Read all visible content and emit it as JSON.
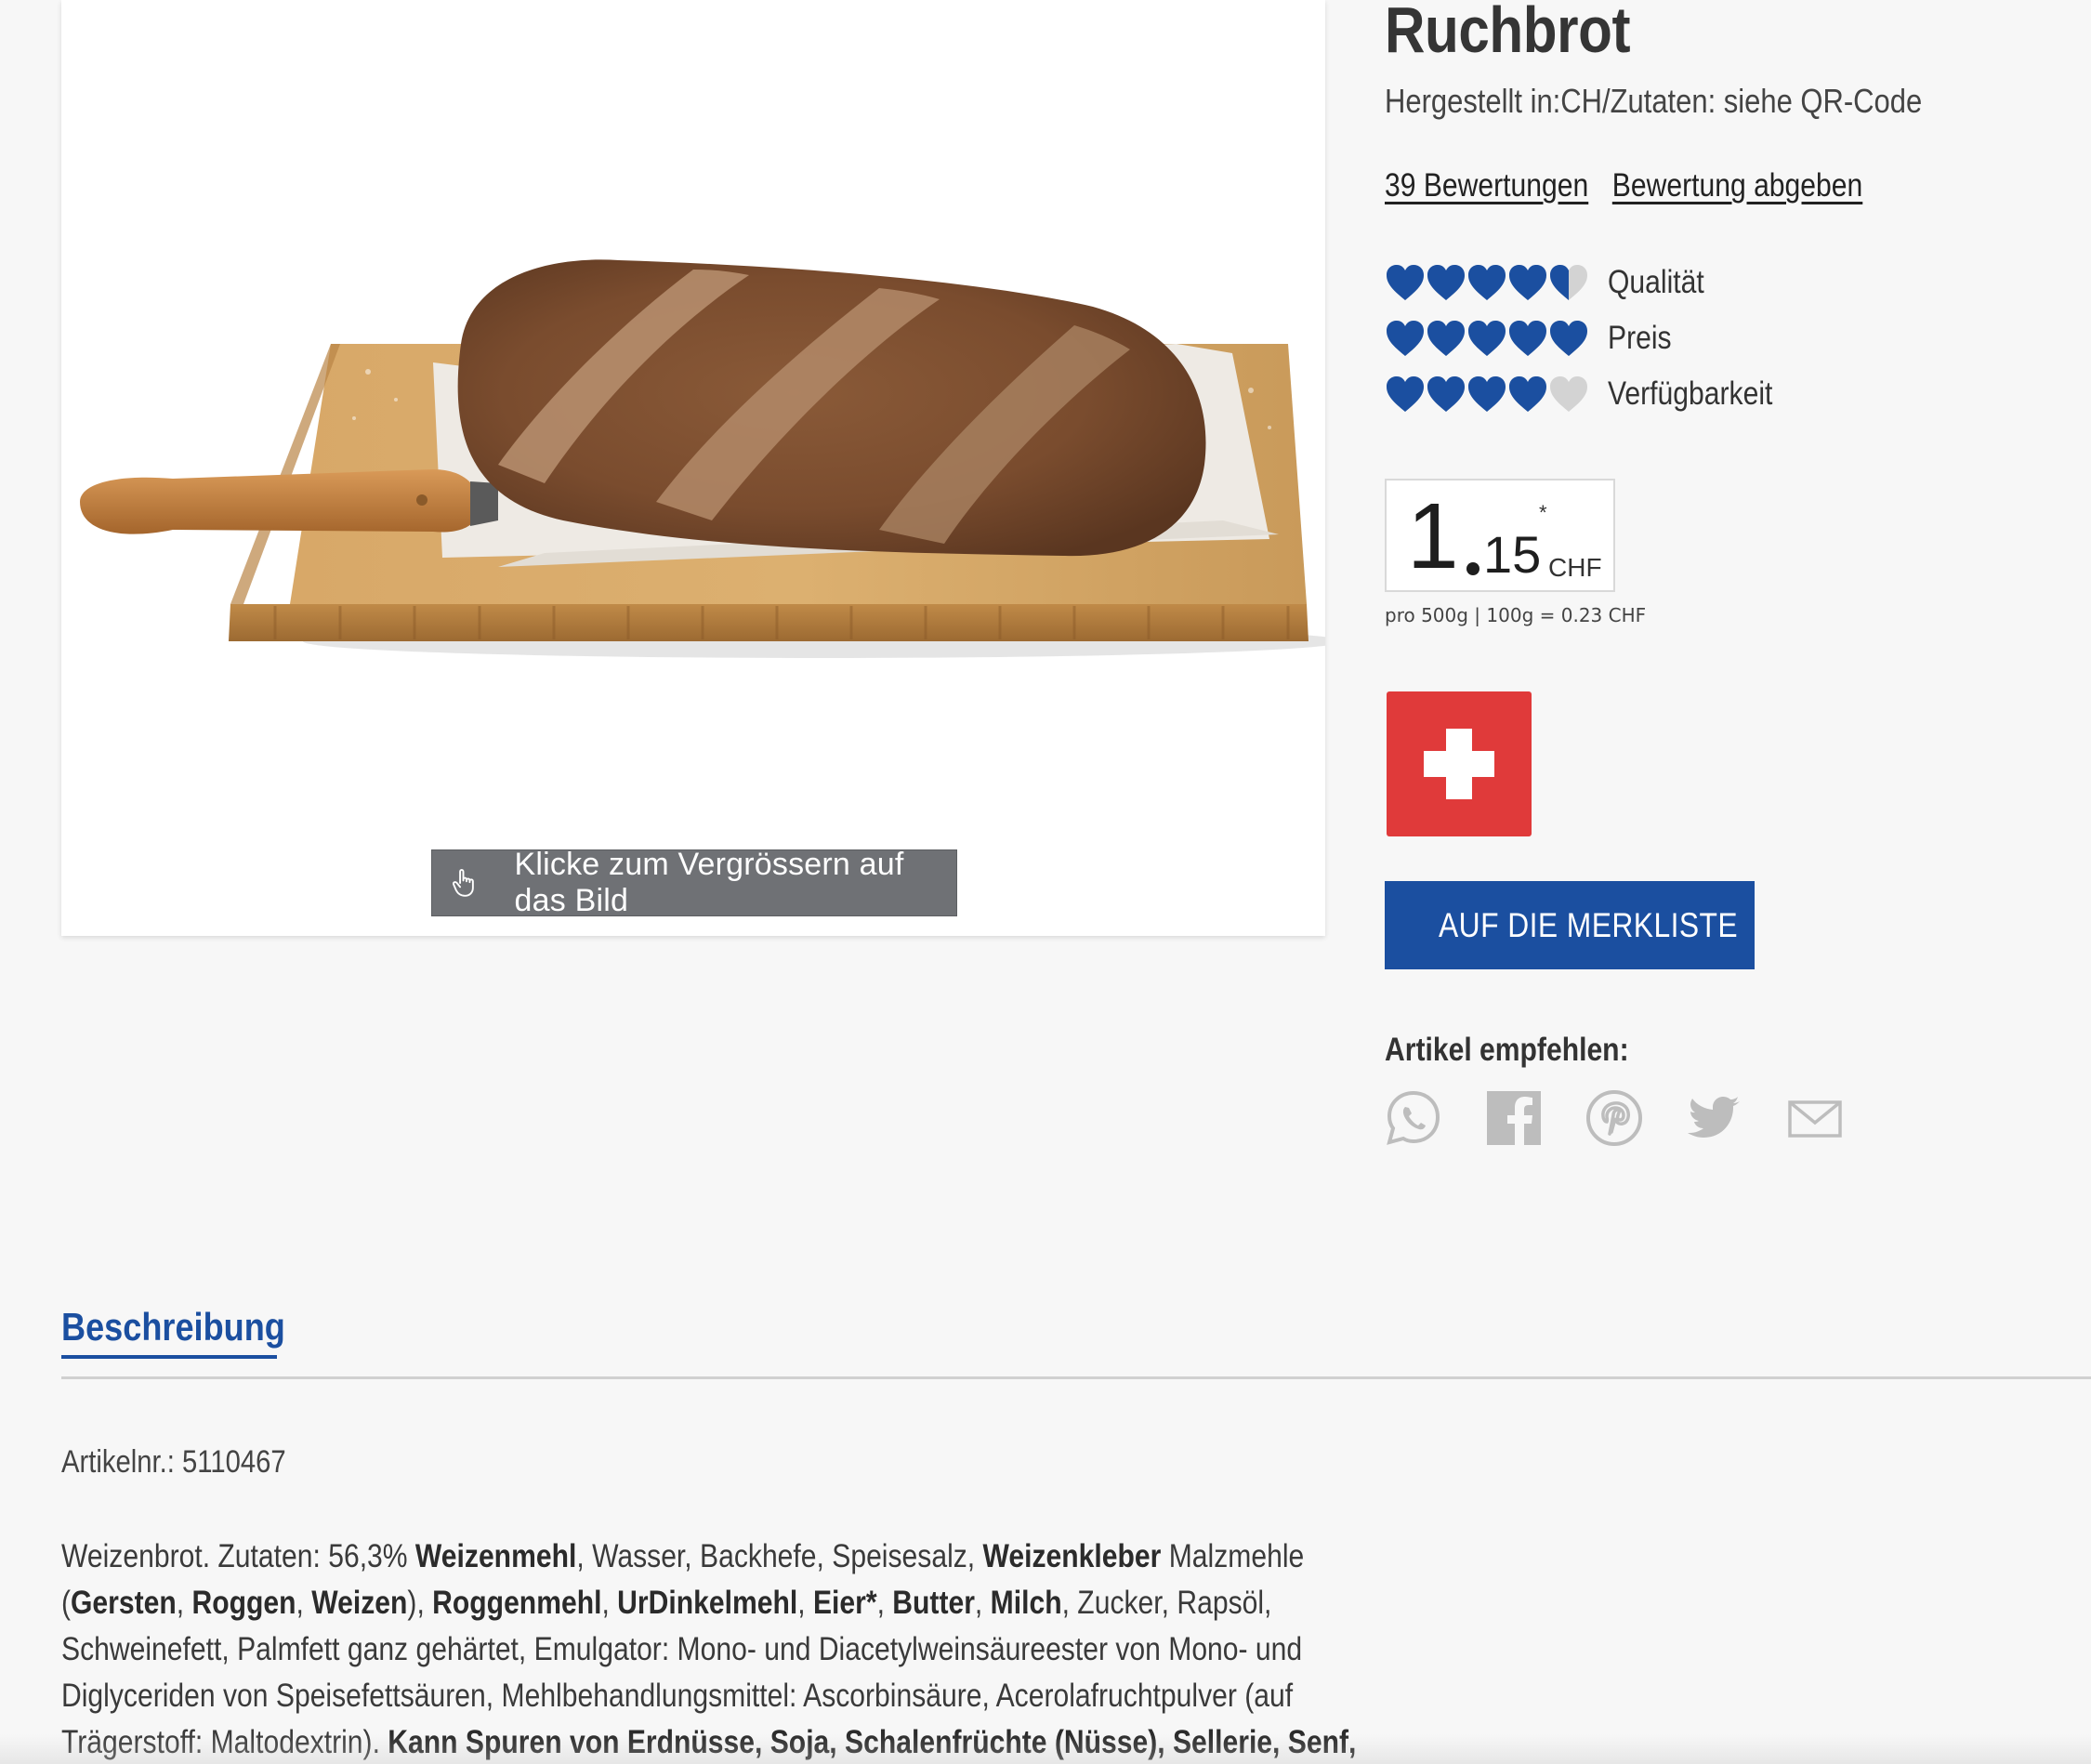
{
  "product": {
    "title": "Ruchbrot",
    "made_in": "Hergestellt in:CH/Zutaten: siehe QR-Code",
    "image_alt": "Ruchbrot auf Holzbrett mit Messer"
  },
  "image": {
    "zoom_hint": "Klicke zum Vergrössern auf das Bild"
  },
  "reviews": {
    "count_link": "39 Bewertungen",
    "write_link": "Bewertung abgeben"
  },
  "ratings": [
    {
      "label": "Qualität",
      "value": 4.5,
      "max": 5
    },
    {
      "label": "Preis",
      "value": 5,
      "max": 5
    },
    {
      "label": "Verfügbarkeit",
      "value": 4,
      "max": 5
    }
  ],
  "price": {
    "whole": "1",
    "cents": "15",
    "footnote_mark": "*",
    "currency": "CHF",
    "unit_price": "pro 500g | 100g = 0.23 CHF"
  },
  "wishlist": {
    "label": "AUF DIE MERKLISTE"
  },
  "share": {
    "title": "Artikel empfehlen:",
    "icons": [
      "whatsapp-icon",
      "facebook-icon",
      "pinterest-icon",
      "twitter-icon",
      "mail-icon"
    ]
  },
  "description": {
    "tab_label": "Beschreibung",
    "article_number": "Artikelnr.: 5110467",
    "ingredients": [
      {
        "t": "Weizenbrot. Zutaten: 56,3% "
      },
      {
        "t": "Weizenmehl",
        "b": true
      },
      {
        "t": ", Wasser, Backhefe, Speisesalz, "
      },
      {
        "t": "Weizenkleber",
        "b": true
      },
      {
        "t": " Malzmehle ("
      },
      {
        "t": "Gersten",
        "b": true
      },
      {
        "t": ", "
      },
      {
        "t": "Roggen",
        "b": true
      },
      {
        "t": ", "
      },
      {
        "t": "Weizen",
        "b": true
      },
      {
        "t": "), "
      },
      {
        "t": "Roggenmehl",
        "b": true
      },
      {
        "t": ", "
      },
      {
        "t": "UrDinkelmehl",
        "b": true
      },
      {
        "t": ", "
      },
      {
        "t": "Eier*",
        "b": true
      },
      {
        "t": ", "
      },
      {
        "t": "Butter",
        "b": true
      },
      {
        "t": ", "
      },
      {
        "t": "Milch",
        "b": true
      },
      {
        "t": ", Zucker, Rapsöl, Schweinefett, Palmfett ganz gehärtet, Emulgator: Mono- und Diacetylweinsäureester von Mono- und Diglyceriden von Speisefettsäuren, Mehlbehandlungsmittel: Ascorbinsäure, Acerolafruchtpulver (auf Trägerstoff: Maltodextrin). "
      },
      {
        "t": "Kann Spuren von Erdnüsse, Soja, Schalenfrüchte (Nüsse), Sellerie, Senf,",
        "b": true
      }
    ]
  },
  "colors": {
    "accent_blue": "#1b4fa0",
    "heart_blue": "#1b4fa0",
    "heart_grey": "#d3d3d3",
    "swiss_red": "#e03a3a",
    "background": "#f7f7f7"
  }
}
